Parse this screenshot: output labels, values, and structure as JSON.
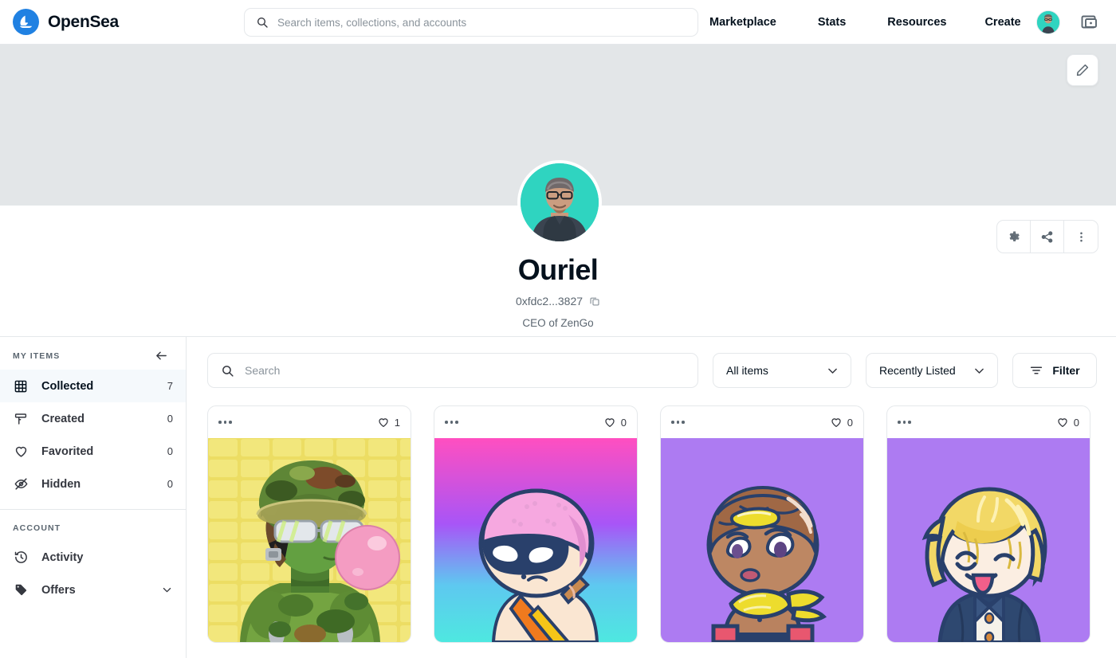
{
  "header": {
    "brand": "OpenSea",
    "brand_logo_icon": "opensea-ship-logo",
    "search": {
      "placeholder": "Search items, collections, and accounts",
      "value": "",
      "icon": "search-icon"
    },
    "links": [
      {
        "label": "Marketplace"
      },
      {
        "label": "Stats"
      },
      {
        "label": "Resources"
      },
      {
        "label": "Create"
      }
    ],
    "avatar_icon": "account-avatar",
    "wallet_icon": "wallet-icon"
  },
  "banner": {
    "edit_icon": "pencil-icon",
    "background_color": "#e3e6e8"
  },
  "profile": {
    "name": "Ouriel",
    "address": "0xfdc2...3827",
    "copy_icon": "copy-icon",
    "bio": "CEO of ZenGo",
    "avatar_icon": "profile-avatar",
    "avatar_background": "#2fd4c0",
    "actions": [
      {
        "name": "settings",
        "icon": "gear-icon"
      },
      {
        "name": "share",
        "icon": "share-icon"
      },
      {
        "name": "more",
        "icon": "more-vertical-icon"
      }
    ]
  },
  "sidebar": {
    "my_items_title": "MY ITEMS",
    "collapse_icon": "arrow-left-icon",
    "items": [
      {
        "label": "Collected",
        "count": "7",
        "icon": "grid-icon",
        "active": true
      },
      {
        "label": "Created",
        "count": "0",
        "icon": "brush-icon",
        "active": false
      },
      {
        "label": "Favorited",
        "count": "0",
        "icon": "heart-icon",
        "active": false
      },
      {
        "label": "Hidden",
        "count": "0",
        "icon": "eye-off-icon",
        "active": false
      }
    ],
    "account_title": "ACCOUNT",
    "account_items": [
      {
        "label": "Activity",
        "icon": "history-icon",
        "chevron": false
      },
      {
        "label": "Offers",
        "icon": "tag-icon",
        "chevron": true
      }
    ],
    "active_background": "#f5f9fc"
  },
  "toolbar": {
    "search": {
      "placeholder": "Search",
      "value": "",
      "icon": "search-icon"
    },
    "items_filter": {
      "label": "All items",
      "icon": "chevron-down-icon"
    },
    "sort": {
      "label": "Recently Listed",
      "icon": "chevron-down-icon"
    },
    "filter": {
      "label": "Filter",
      "icon": "filter-icon"
    }
  },
  "cards": [
    {
      "likes": "1",
      "menu_icon": "more-horizontal-icon",
      "heart_icon": "heart-icon",
      "art": "camo-soldier-bubblegum",
      "background": "#ecdd63"
    },
    {
      "likes": "0",
      "menu_icon": "more-horizontal-icon",
      "heart_icon": "heart-icon",
      "art": "masked-pink-hair-character",
      "background_gradient": [
        "#ff4fc0",
        "#a855f7",
        "#4ee8e0"
      ]
    },
    {
      "likes": "0",
      "menu_icon": "more-horizontal-icon",
      "heart_icon": "heart-icon",
      "art": "yellow-scarf-character",
      "background": "#ad7bf2"
    },
    {
      "likes": "0",
      "menu_icon": "more-horizontal-icon",
      "heart_icon": "heart-icon",
      "art": "blonde-tongue-out-character",
      "background": "#ad7bf2"
    }
  ],
  "colors": {
    "accent": "#2081e2",
    "border": "#e5e8eb",
    "text": "#04111d",
    "muted": "#5b6670"
  }
}
